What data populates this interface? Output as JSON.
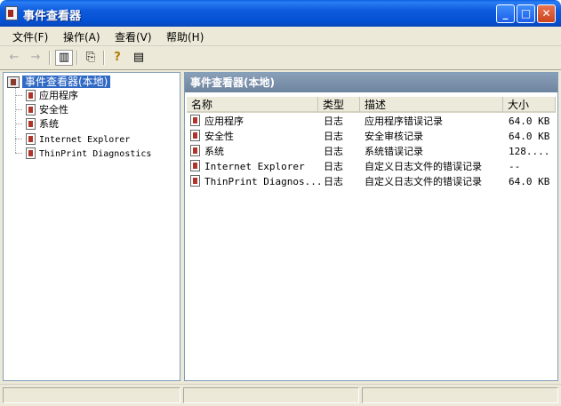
{
  "window": {
    "title": "事件查看器",
    "controls": {
      "minimize": "_",
      "maximize": "□",
      "close": "✕"
    }
  },
  "menu": [
    {
      "label": "文件(F)"
    },
    {
      "label": "操作(A)"
    },
    {
      "label": "查看(V)"
    },
    {
      "label": "帮助(H)"
    }
  ],
  "toolbar": {
    "back_icon": "←",
    "forward_icon": "→",
    "tree_toggle_icon": "▥",
    "export_icon": "⎘",
    "help_icon": "?",
    "properties_icon": "▤"
  },
  "tree": {
    "root": "事件查看器(本地)",
    "items": [
      {
        "label": "应用程序"
      },
      {
        "label": "安全性"
      },
      {
        "label": "系统"
      },
      {
        "label": "Internet Explorer"
      },
      {
        "label": "ThinPrint Diagnostics"
      }
    ]
  },
  "right_pane": {
    "header": "事件查看器(本地)",
    "columns": {
      "name": "名称",
      "type": "类型",
      "description": "描述",
      "size": "大小"
    },
    "rows": [
      {
        "name": "应用程序",
        "type": "日志",
        "description": "应用程序错误记录",
        "size": "64.0 KB"
      },
      {
        "name": "安全性",
        "type": "日志",
        "description": "安全审核记录",
        "size": "64.0 KB"
      },
      {
        "name": "系统",
        "type": "日志",
        "description": "系统错误记录",
        "size": "128...."
      },
      {
        "name": "Internet Explorer",
        "type": "日志",
        "description": "自定义日志文件的错误记录",
        "size": "--"
      },
      {
        "name": "ThinPrint Diagnos...",
        "type": "日志",
        "description": "自定义日志文件的错误记录",
        "size": "64.0 KB"
      }
    ]
  },
  "colors": {
    "titlebar": "#0450d3",
    "selection": "#316ac5",
    "header": "#7b8faa"
  }
}
